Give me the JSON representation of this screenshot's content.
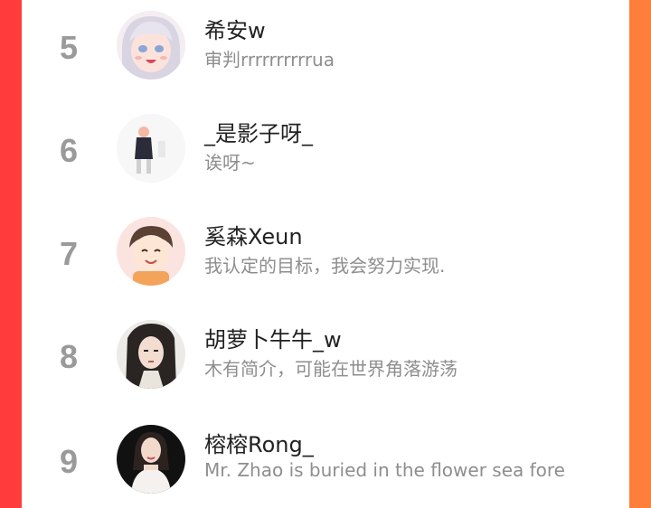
{
  "colors": {
    "background_left": "#ff3b3b",
    "background_right": "#ff7f3a",
    "card": "#ffffff",
    "rank": "#9a9a9a",
    "name": "#222222",
    "bio": "#8e8e8e"
  },
  "leaderboard": {
    "rows": [
      {
        "rank": "5",
        "name": "希安w",
        "bio": "审判rrrrrrrrrrua",
        "avatar": "anime-girl-avatar"
      },
      {
        "rank": "6",
        "name": "_是影子呀_",
        "bio": "诶呀~",
        "avatar": "figure-photo-avatar"
      },
      {
        "rank": "7",
        "name": "奚森Xeun",
        "bio": "我认定的目标，我会努力实现.",
        "avatar": "cartoon-boy-avatar"
      },
      {
        "rank": "8",
        "name": "胡萝卜牛牛_w",
        "bio": "木有简介，可能在世界角落游荡",
        "avatar": "ancient-style-avatar"
      },
      {
        "rank": "9",
        "name": "榕榕Rong_",
        "bio": "Mr. Zhao is buried in the flower sea fore",
        "avatar": "woman-photo-avatar"
      }
    ]
  }
}
